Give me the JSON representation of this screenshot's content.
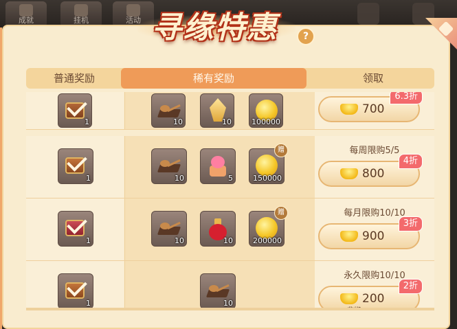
{
  "hud": {
    "buttons": [
      "成就",
      "挂机",
      "活动"
    ]
  },
  "title": "寻缘特惠",
  "help_icon": "?",
  "tabs": [
    {
      "label": "普通奖励"
    },
    {
      "label": "稀有奖励"
    },
    {
      "label": "领取"
    }
  ],
  "rows": [
    {
      "normal": {
        "icon": "chest-icon",
        "count": "1"
      },
      "rare": [
        {
          "icon": "wooden-spoon-icon",
          "count": "10"
        },
        {
          "icon": "crystal-icon",
          "count": "10"
        },
        {
          "icon": "gold-coin-icon",
          "count": "100000"
        }
      ],
      "limit": "",
      "price": "700",
      "discount": "6.3折"
    },
    {
      "normal": {
        "icon": "chest-icon",
        "count": "1"
      },
      "rare": [
        {
          "icon": "wooden-spoon-icon",
          "count": "10"
        },
        {
          "icon": "flower-pot-icon",
          "count": "5"
        },
        {
          "icon": "gold-coin-icon",
          "count": "150000",
          "gift": "赠"
        }
      ],
      "limit": "每周限购5/5",
      "price": "800",
      "discount": "4折"
    },
    {
      "normal": {
        "icon": "red-chest-icon",
        "count": "1"
      },
      "rare": [
        {
          "icon": "wooden-spoon-icon",
          "count": "10"
        },
        {
          "icon": "red-potion-icon",
          "count": "10"
        },
        {
          "icon": "gold-coin-icon",
          "count": "200000",
          "gift": "赠"
        }
      ],
      "limit": "每月限购10/10",
      "price": "900",
      "discount": "3折"
    },
    {
      "normal": {
        "icon": "chest-icon",
        "count": "1"
      },
      "rare": [
        {
          "icon": "wooden-spoon-icon",
          "count": "10"
        }
      ],
      "limit": "永久限购10/10",
      "price": "200",
      "discount": "2折",
      "sub": "非绑"
    }
  ],
  "colors": {
    "accent": "#ef9b58",
    "panel": "#f9eccf",
    "discount": "#f36a6c"
  }
}
